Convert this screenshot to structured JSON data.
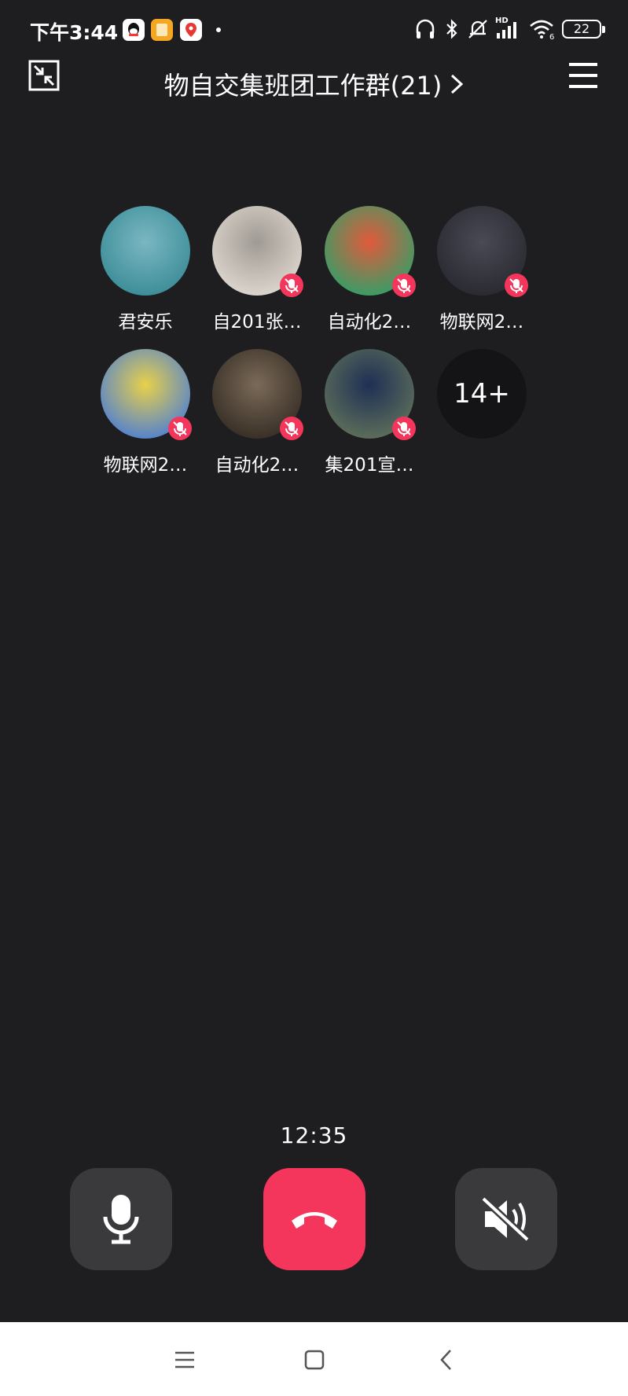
{
  "status_bar": {
    "time": "下午3:44",
    "battery": "22",
    "network_label": "HD",
    "wifi_sub": "6",
    "app_icons": [
      "qq-icon",
      "notes-icon",
      "maps-icon"
    ],
    "right_icons": [
      "headset-icon",
      "bluetooth-icon",
      "mute-bell-icon",
      "signal-icon",
      "wifi-icon",
      "battery-icon"
    ]
  },
  "header": {
    "title": "物自交集班团工作群(21)",
    "left_icon": "minimize-icon",
    "right_icon": "menu-icon"
  },
  "members": [
    {
      "name": "君安乐",
      "muted": false,
      "colors": [
        "#3f8f9a",
        "#7ab7c2"
      ]
    },
    {
      "name": "自201张…",
      "muted": true,
      "colors": [
        "#d9d3cb",
        "#a09a94"
      ]
    },
    {
      "name": "自动化2…",
      "muted": true,
      "colors": [
        "#3f9a64",
        "#e25a3c"
      ]
    },
    {
      "name": "物联网2…",
      "muted": true,
      "colors": [
        "#2b2b33",
        "#4a4a55"
      ]
    },
    {
      "name": "物联网2…",
      "muted": true,
      "colors": [
        "#5a86c8",
        "#e8d04a"
      ]
    },
    {
      "name": "自动化2…",
      "muted": true,
      "colors": [
        "#3a3128",
        "#7b6a58"
      ]
    },
    {
      "name": "集201宣…",
      "muted": true,
      "colors": [
        "#5a6b5a",
        "#1e2f55"
      ]
    }
  ],
  "more_count": "14+",
  "call": {
    "timer": "12:35",
    "buttons": [
      "microphone-button",
      "hang-up-button",
      "speaker-off-button"
    ]
  },
  "colors": {
    "background": "#1e1e21",
    "accent_red": "#f5365c",
    "button_gray": "#3a3a3d"
  },
  "nav_bar": [
    "recent-apps-icon",
    "home-icon",
    "back-icon"
  ]
}
